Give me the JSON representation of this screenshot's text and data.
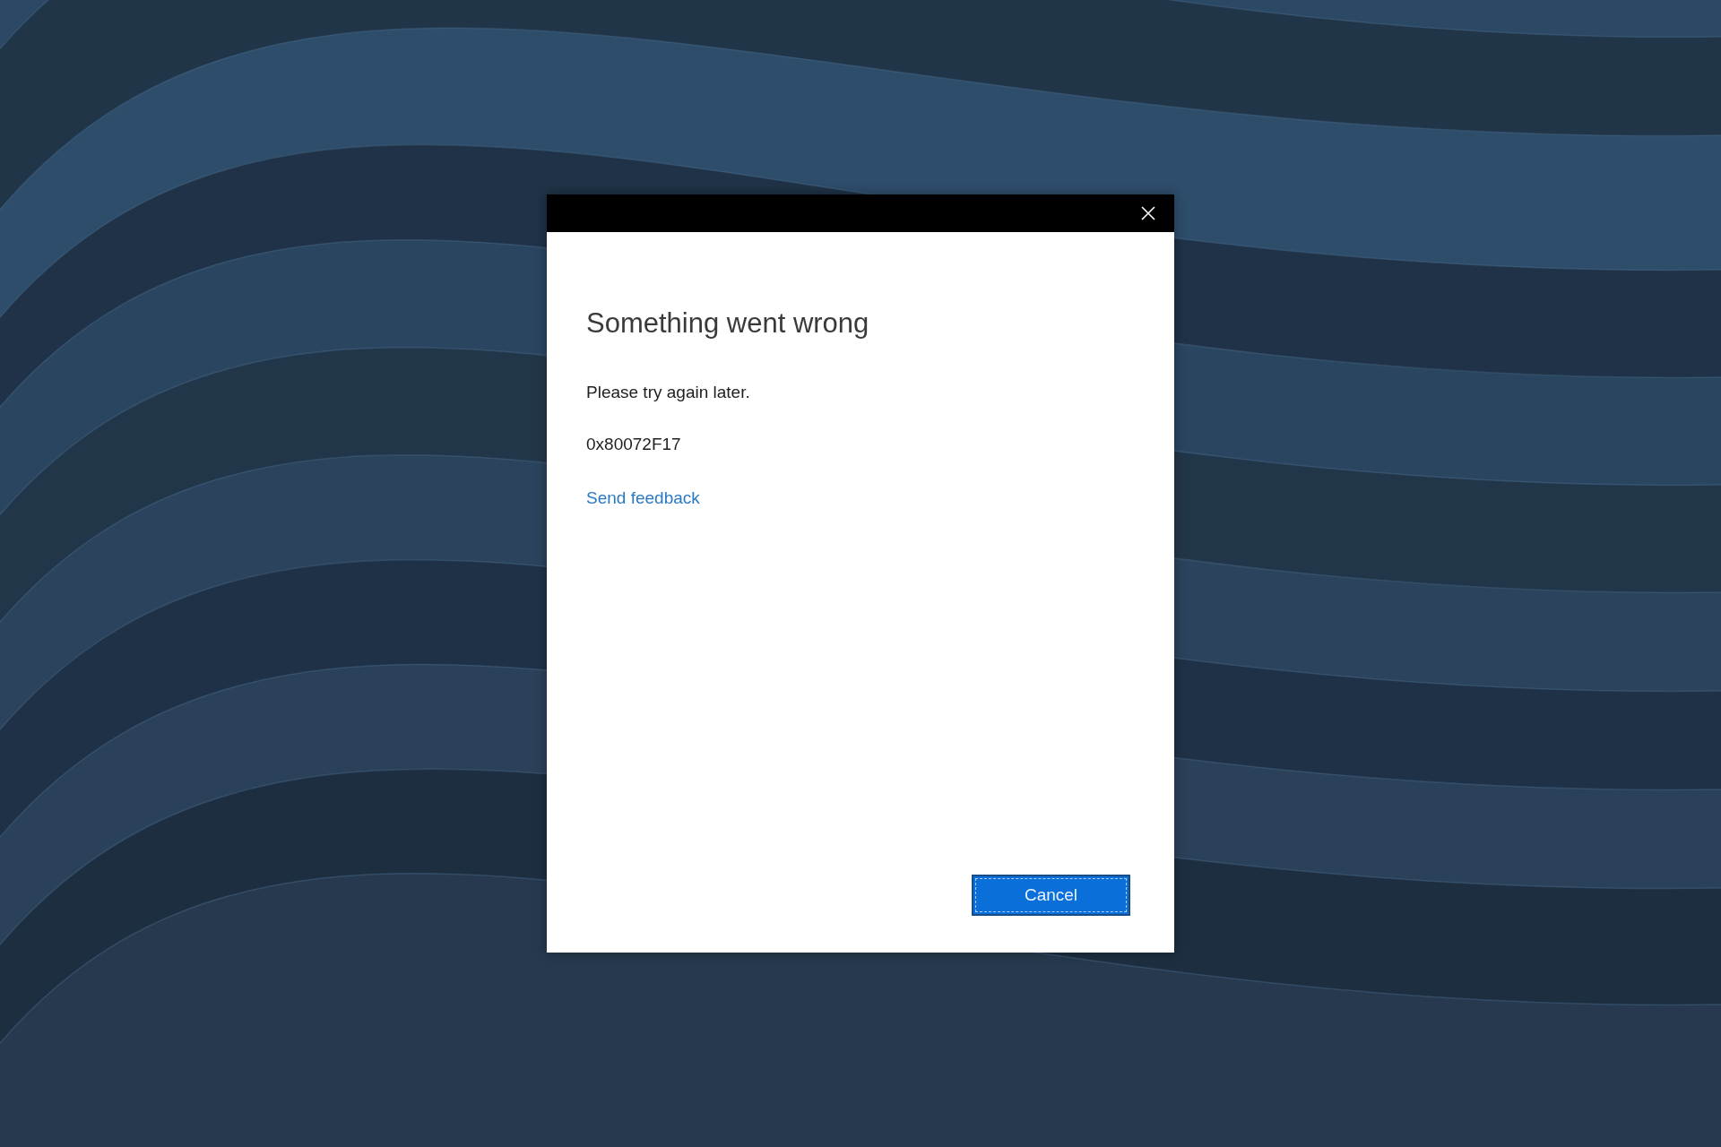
{
  "dialog": {
    "title": "Something went wrong",
    "message": "Please try again later.",
    "error_code": "0x80072F17",
    "link": "Send feedback",
    "buttons": [
      {
        "label": "Cancel",
        "focused": true
      }
    ]
  }
}
